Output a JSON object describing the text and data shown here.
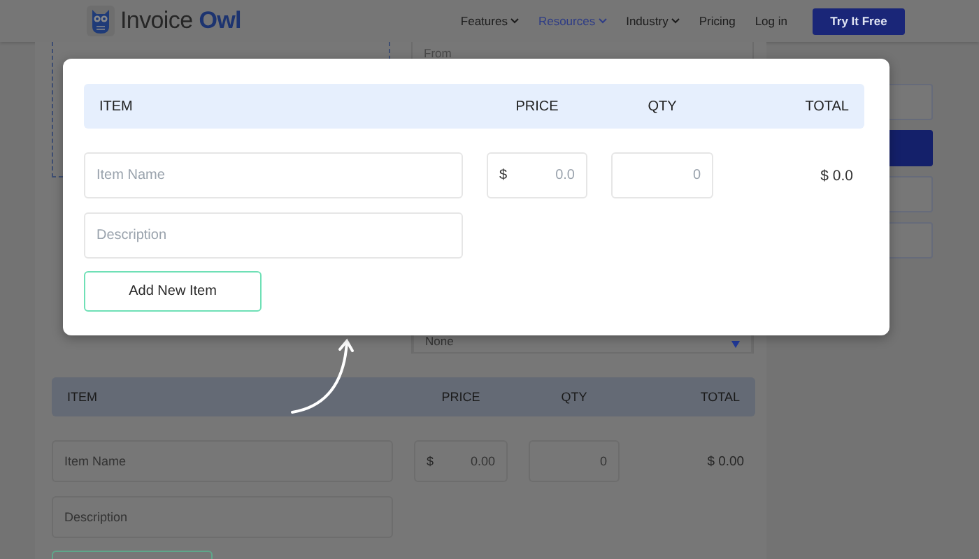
{
  "nav": {
    "logo": "Invoice **Owl**",
    "items": [
      {
        "label": "Features",
        "dropdown": true,
        "selected": false
      },
      {
        "label": "Resources",
        "dropdown": true,
        "selected": true
      },
      {
        "label": "Industry",
        "dropdown": true,
        "selected": false
      },
      {
        "label": "Pricing",
        "dropdown": false,
        "selected": false
      },
      {
        "label": "Log in",
        "dropdown": false,
        "selected": false
      }
    ],
    "cta": "Try It Free"
  },
  "form": {
    "from_label": "From",
    "tax_select": {
      "value": "None"
    },
    "table": {
      "columns": [
        "ITEM",
        "PRICE",
        "QTY",
        "TOTAL"
      ],
      "rows": [
        {
          "item_placeholder": "Item Name",
          "description_placeholder": "Description",
          "currency": "$",
          "price_placeholder": "0.00",
          "qty_placeholder": "0",
          "total": "$ 0.00"
        }
      ]
    }
  },
  "modal": {
    "table": {
      "columns": [
        "ITEM",
        "PRICE",
        "QTY",
        "TOTAL"
      ],
      "rows": [
        {
          "item_placeholder": "Item Name",
          "description_placeholder": "Description",
          "currency": "$",
          "price_placeholder": "0.0",
          "qty_placeholder": "0",
          "total": "$ 0.0"
        }
      ]
    },
    "add_button": "Add New Item"
  }
}
